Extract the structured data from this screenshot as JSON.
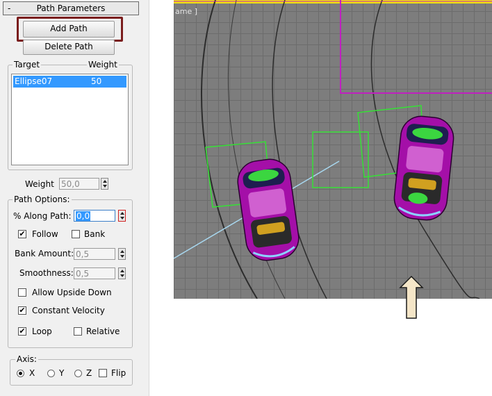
{
  "panel": {
    "title": "Path Parameters",
    "collapse_glyph": "-",
    "add_path_label": "Add Path",
    "delete_path_label": "Delete Path",
    "targets_list": {
      "columns": [
        "Target",
        "Weight"
      ],
      "rows": [
        {
          "target": "Ellipse07",
          "weight": "50",
          "selected": true
        }
      ]
    },
    "weight_label": "Weight",
    "weight_value": "50,0",
    "path_options": {
      "title": "Path Options:",
      "along_path_label": "% Along Path:",
      "along_path_value": "0,0",
      "follow_label": "Follow",
      "follow_checked": true,
      "bank_label": "Bank",
      "bank_checked": false,
      "bank_amount_label": "Bank Amount:",
      "bank_amount_value": "0,5",
      "smoothness_label": "Smoothness:",
      "smoothness_value": "0,5",
      "allow_upside_down_label": "Allow Upside Down",
      "allow_upside_down_checked": false,
      "constant_velocity_label": "Constant Velocity",
      "constant_velocity_checked": true,
      "loop_label": "Loop",
      "loop_checked": true,
      "relative_label": "Relative",
      "relative_checked": false
    },
    "axis": {
      "title": "Axis:",
      "x_label": "X",
      "y_label": "Y",
      "z_label": "Z",
      "flip_label": "Flip",
      "selected": "X",
      "flip_checked": false
    }
  },
  "viewport": {
    "label_fragment": "ame ]",
    "colors": {
      "background": "#7d7d7d",
      "grid": "#6c6c6c",
      "path_magenta": "#c020c0",
      "helper_green": "#36e036",
      "line_lightblue": "#a8d8f0",
      "car_body": "#a40fa8",
      "top_border": "#f0e010",
      "arrow_fill": "#f5e6c8"
    }
  },
  "icons": {
    "check": "✔"
  }
}
